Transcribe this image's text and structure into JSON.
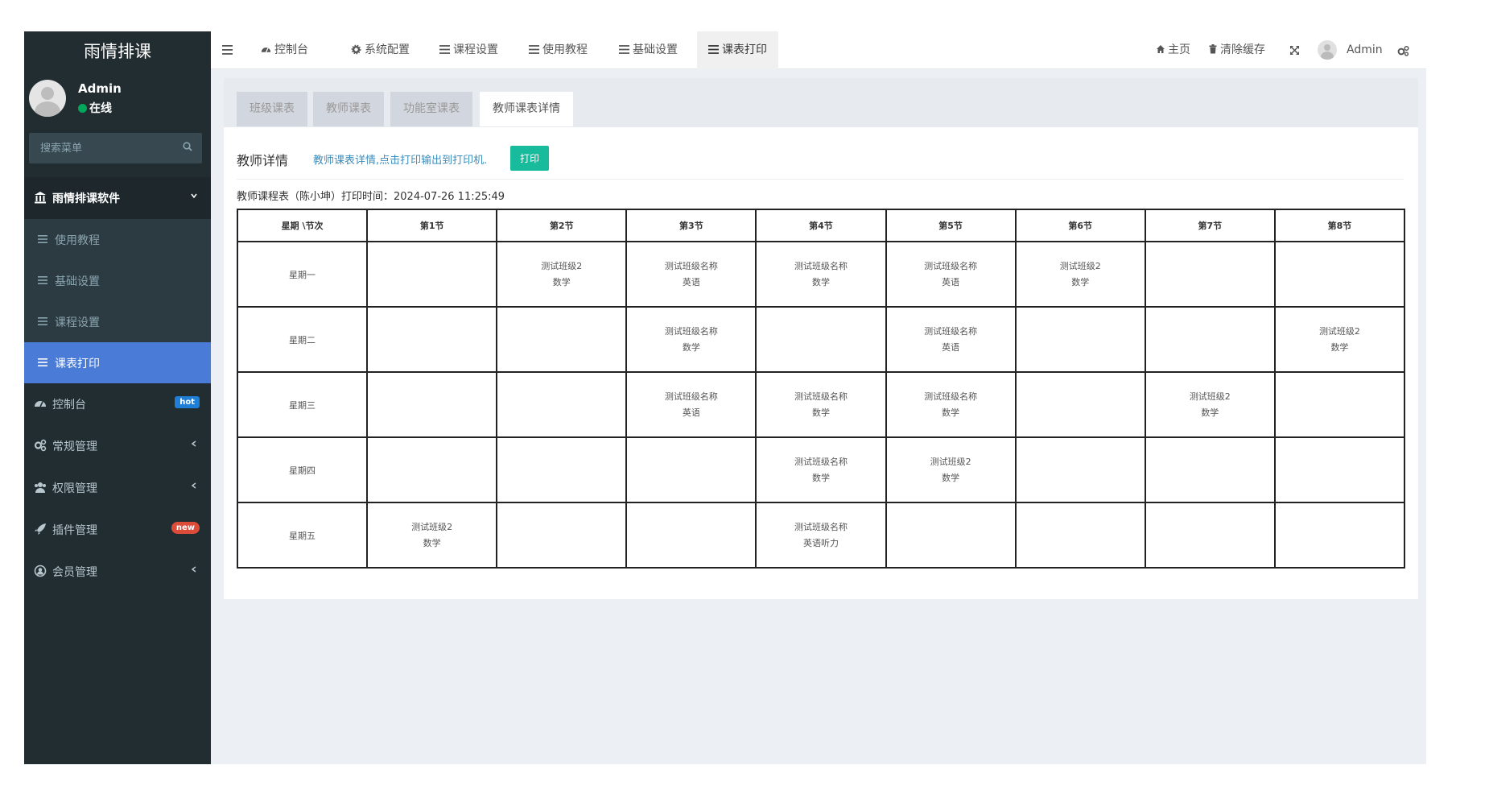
{
  "app": {
    "logo": "雨情排课"
  },
  "user": {
    "name": "Admin",
    "status": "在线"
  },
  "search": {
    "placeholder": "搜索菜单"
  },
  "sidebar": {
    "header": "雨情排课软件",
    "subitems": [
      {
        "label": "使用教程"
      },
      {
        "label": "基础设置"
      },
      {
        "label": "课程设置"
      },
      {
        "label": "课表打印"
      }
    ],
    "items": [
      {
        "label": "控制台",
        "badge": "hot"
      },
      {
        "label": "常规管理"
      },
      {
        "label": "权限管理"
      },
      {
        "label": "插件管理",
        "badge": "new"
      },
      {
        "label": "会员管理"
      }
    ]
  },
  "topnav": {
    "tabs": [
      {
        "label": "控制台"
      },
      {
        "label": "系统配置"
      },
      {
        "label": "课程设置"
      },
      {
        "label": "使用教程"
      },
      {
        "label": "基础设置"
      },
      {
        "label": "课表打印"
      }
    ],
    "home": "主页",
    "clear_cache": "清除缓存",
    "admin": "Admin"
  },
  "content": {
    "tabs": [
      {
        "label": "班级课表"
      },
      {
        "label": "教师课表"
      },
      {
        "label": "功能室课表"
      },
      {
        "label": "教师课表详情"
      }
    ],
    "detail_title": "教师详情",
    "detail_link": "教师课表详情,点击打印输出到打印机.",
    "print_button": "打印",
    "caption": "教师课程表（陈小坤）打印时间：2024-07-26 11:25:49"
  },
  "schedule": {
    "header": [
      "星期 \\节次",
      "第1节",
      "第2节",
      "第3节",
      "第4节",
      "第5节",
      "第6节",
      "第7节",
      "第8节"
    ],
    "rows": [
      {
        "day": "星期一",
        "cells": [
          [
            "",
            ""
          ],
          [
            "测试班级2",
            "数学"
          ],
          [
            "测试班级名称",
            "英语"
          ],
          [
            "测试班级名称",
            "数学"
          ],
          [
            "测试班级名称",
            "英语"
          ],
          [
            "测试班级2",
            "数学"
          ],
          [
            "",
            ""
          ],
          [
            "",
            ""
          ]
        ]
      },
      {
        "day": "星期二",
        "cells": [
          [
            "",
            ""
          ],
          [
            "",
            ""
          ],
          [
            "测试班级名称",
            "数学"
          ],
          [
            "",
            ""
          ],
          [
            "测试班级名称",
            "英语"
          ],
          [
            "",
            ""
          ],
          [
            "",
            ""
          ],
          [
            "测试班级2",
            "数学"
          ]
        ]
      },
      {
        "day": "星期三",
        "cells": [
          [
            "",
            ""
          ],
          [
            "",
            ""
          ],
          [
            "测试班级名称",
            "英语"
          ],
          [
            "测试班级名称",
            "数学"
          ],
          [
            "测试班级名称",
            "数学"
          ],
          [
            "",
            ""
          ],
          [
            "测试班级2",
            "数学"
          ],
          [
            "",
            ""
          ]
        ]
      },
      {
        "day": "星期四",
        "cells": [
          [
            "",
            ""
          ],
          [
            "",
            ""
          ],
          [
            "",
            ""
          ],
          [
            "测试班级名称",
            "数学"
          ],
          [
            "测试班级2",
            "数学"
          ],
          [
            "",
            ""
          ],
          [
            "",
            ""
          ],
          [
            "",
            ""
          ]
        ]
      },
      {
        "day": "星期五",
        "cells": [
          [
            "测试班级2",
            "数学"
          ],
          [
            "",
            ""
          ],
          [
            "",
            ""
          ],
          [
            "测试班级名称",
            "英语听力"
          ],
          [
            "",
            ""
          ],
          [
            "",
            ""
          ],
          [
            "",
            ""
          ],
          [
            "",
            ""
          ]
        ]
      }
    ]
  },
  "colors": {
    "sidebar_bg": "#222d32",
    "active_menu": "#4a7bd6",
    "print_button": "#18bc9c",
    "link": "#3c8dbc"
  }
}
